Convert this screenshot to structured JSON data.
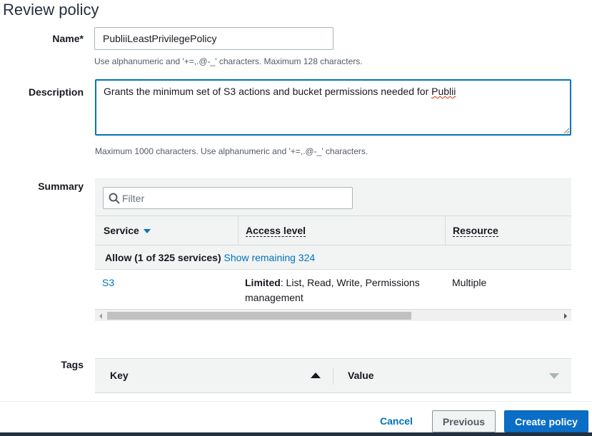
{
  "page": {
    "title": "Review policy"
  },
  "name_field": {
    "label": "Name*",
    "value": "PubliiLeastPrivilegePolicy",
    "hint": "Use alphanumeric and '+=,.@-_' characters. Maximum 128 characters."
  },
  "description_field": {
    "label": "Description",
    "value_prefix": "Grants the minimum set of S3 actions and bucket permissions needed for ",
    "value_misspelled": "Publii",
    "hint": "Maximum 1000 characters. Use alphanumeric and '+=,.@-_' characters."
  },
  "summary": {
    "label": "Summary",
    "filter_placeholder": "Filter",
    "columns": {
      "service": "Service",
      "access_level": "Access level",
      "resource": "Resource"
    },
    "group": {
      "title": "Allow (1 of 325 services)",
      "link": "Show remaining 324"
    },
    "rows": [
      {
        "service": "S3",
        "access_level_bold": "Limited",
        "access_level_rest": ": List, Read, Write, Permissions",
        "access_level_line2": "management",
        "resource": "Multiple"
      }
    ]
  },
  "tags": {
    "label": "Tags",
    "columns": {
      "key": "Key",
      "value": "Value"
    }
  },
  "footer": {
    "cancel": "Cancel",
    "previous": "Previous",
    "create": "Create policy"
  },
  "colors": {
    "accent": "#0073bb",
    "primary_button": "#0a6ec6"
  }
}
